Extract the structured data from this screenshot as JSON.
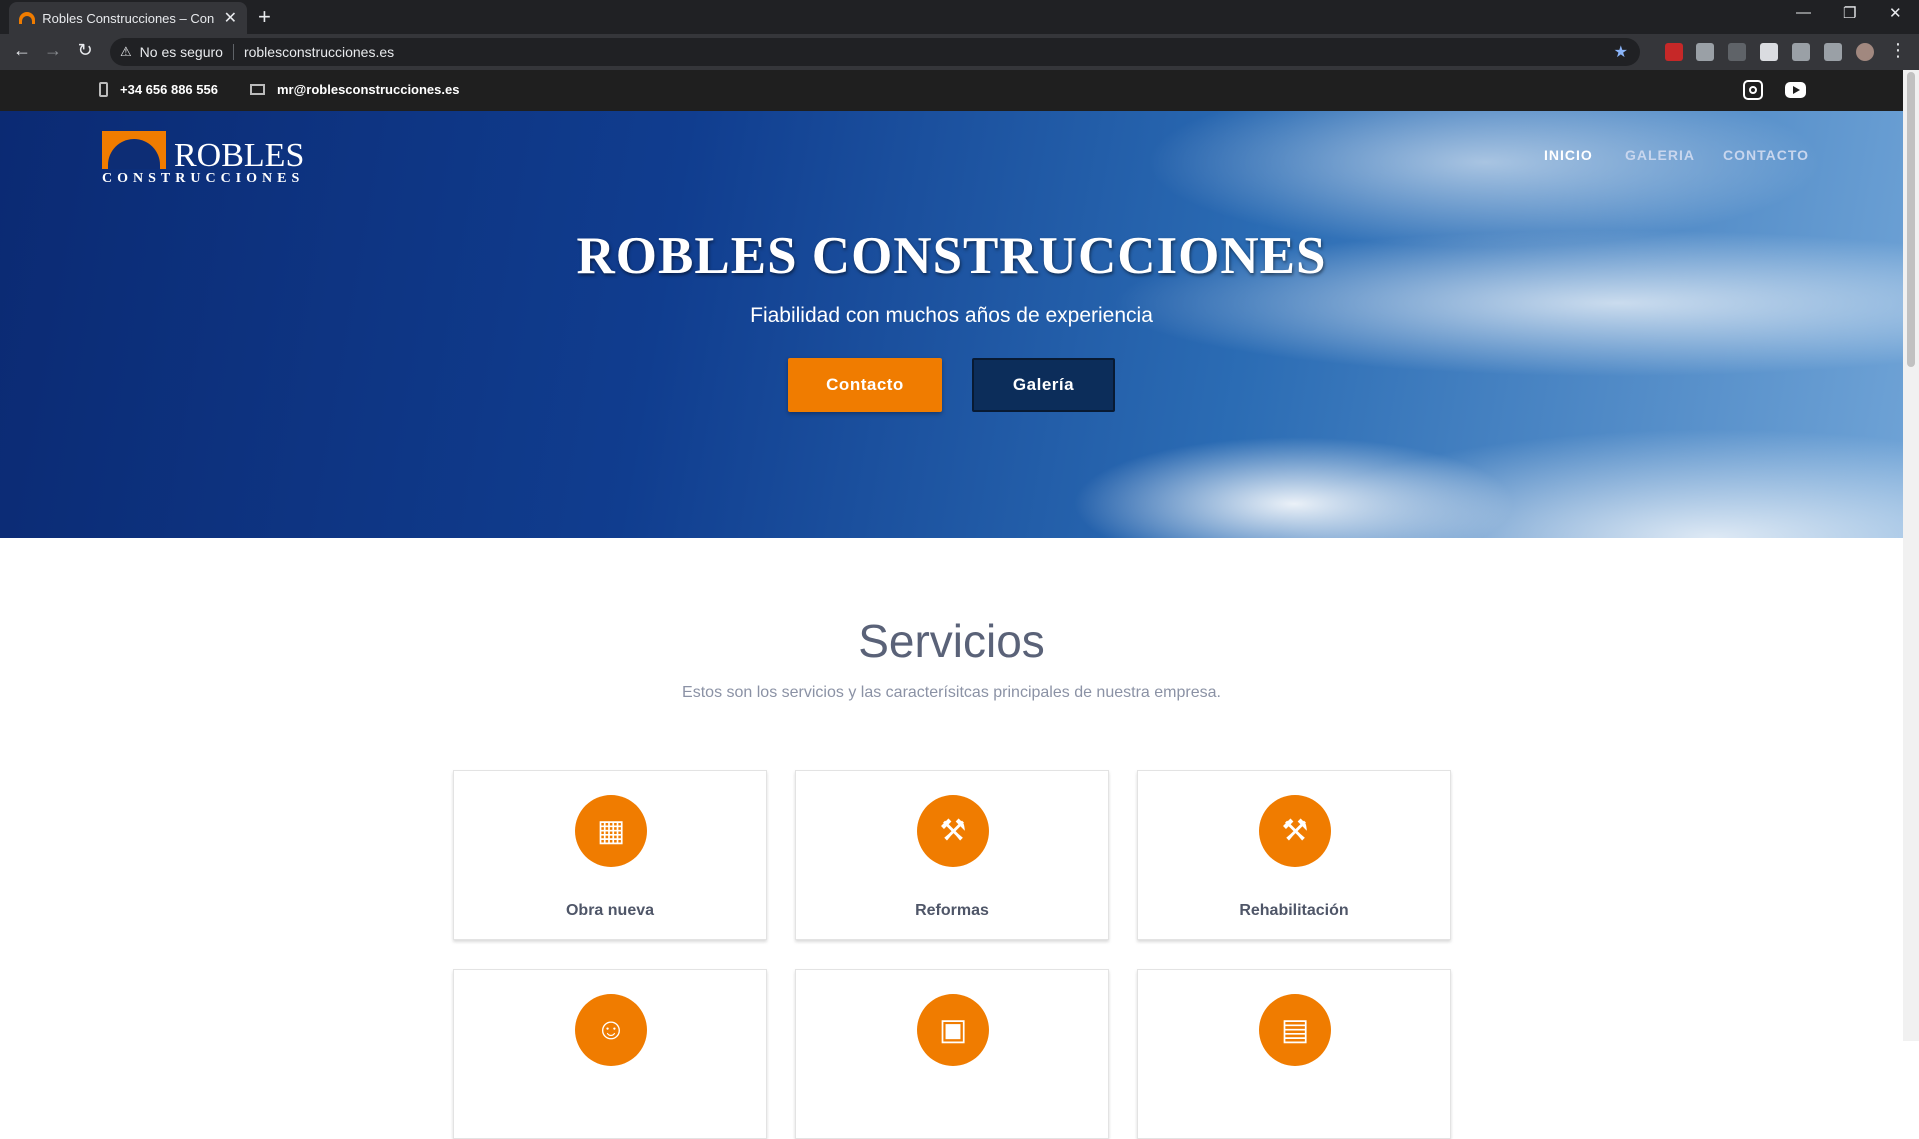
{
  "browser": {
    "tab_title": "Robles Construcciones – Constru",
    "close_glyph": "✕",
    "new_tab_glyph": "+",
    "back_glyph": "←",
    "forward_glyph": "→",
    "reload_glyph": "↻",
    "warning_glyph": "⚠",
    "security_label": "No es seguro",
    "url": "roblesconstrucciones.es",
    "star_glyph": "★",
    "minimize_glyph": "—",
    "restore_glyph": "❐",
    "window_close_glyph": "✕",
    "menu_glyph": "⋮"
  },
  "topbar": {
    "phone": "+34 656 886 556",
    "email": "mr@roblesconstrucciones.es"
  },
  "header": {
    "logo_text": "ROBLES",
    "logo_sub": "CONSTRUCCIONES",
    "nav": [
      {
        "label": "INICIO",
        "active": true
      },
      {
        "label": "GALERIA",
        "active": false
      },
      {
        "label": "CONTACTO",
        "active": false
      }
    ]
  },
  "hero": {
    "title": "ROBLES CONSTRUCCIONES",
    "subtitle": "Fiabilidad con muchos años  de experiencia",
    "primary_button": "Contacto",
    "secondary_button": "Galería"
  },
  "services": {
    "title": "Servicios",
    "subtitle": "Estos son los servicios y las caracterísitcas principales de nuestra empresa.",
    "items": [
      {
        "label": "Obra nueva",
        "icon": "building-icon",
        "glyph": "▦"
      },
      {
        "label": "Reformas",
        "icon": "paint-roller-icon",
        "glyph": "⚒"
      },
      {
        "label": "Rehabilitación",
        "icon": "hammer-icon",
        "glyph": "⚒"
      },
      {
        "label": "",
        "icon": "people-icon",
        "glyph": "☺"
      },
      {
        "label": "",
        "icon": "calendar-clock-icon",
        "glyph": "▣"
      },
      {
        "label": "",
        "icon": "money-icon",
        "glyph": "▤"
      }
    ]
  },
  "colors": {
    "accent": "#f07c00",
    "topbar": "#1f1f1f",
    "text_muted": "#8b92a5"
  }
}
